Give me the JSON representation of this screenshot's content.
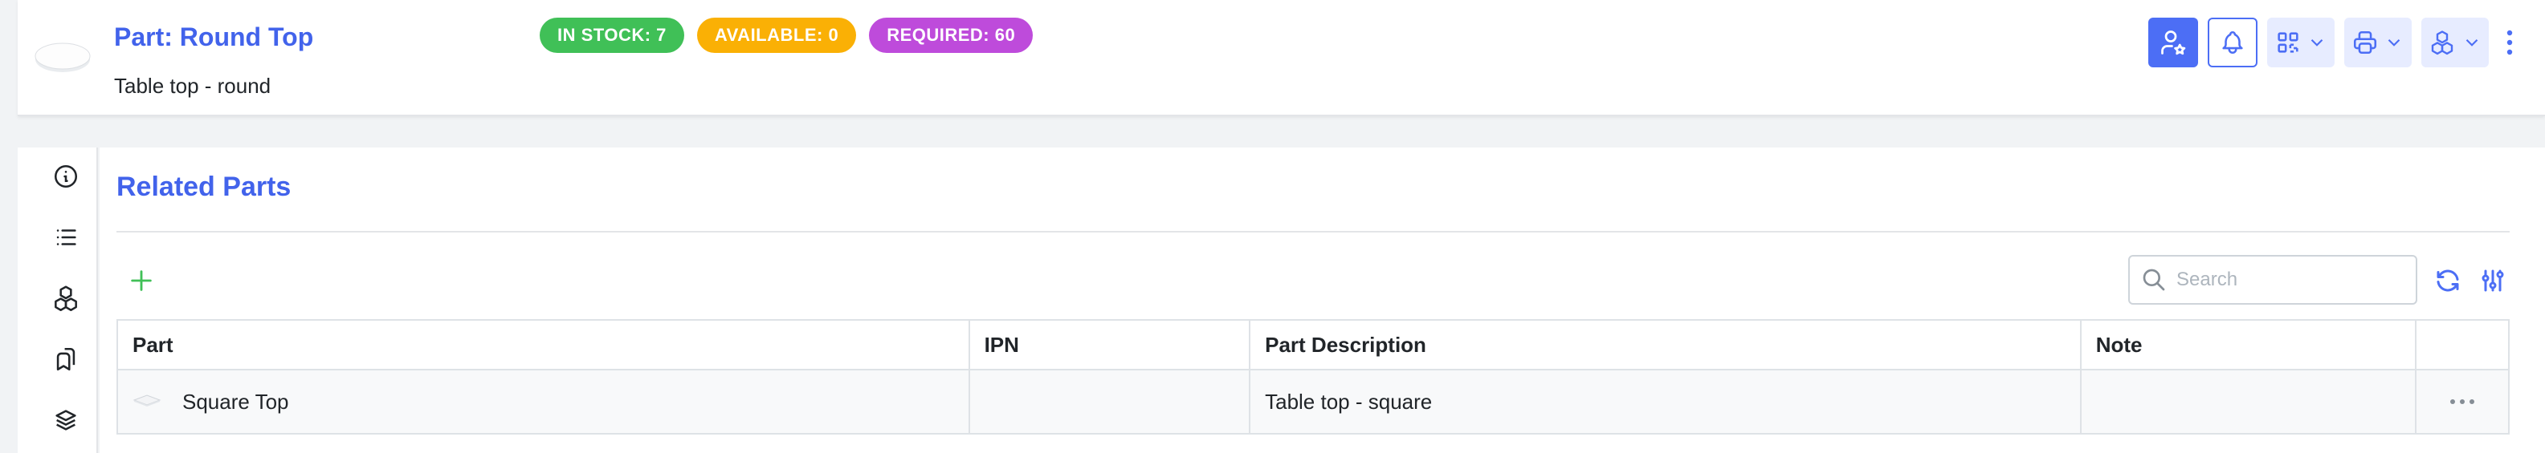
{
  "header": {
    "title": "Part: Round Top",
    "description": "Table top - round",
    "badges": [
      {
        "label": "IN STOCK: 7",
        "color": "#40c057"
      },
      {
        "label": "AVAILABLE: 0",
        "color": "#fab005"
      },
      {
        "label": "REQUIRED: 60",
        "color": "#be4bdb"
      }
    ],
    "actions": [
      "user-star-icon",
      "bell-icon",
      "qr-code-icon",
      "printer-icon",
      "boxes-icon",
      "more-vertical-icon"
    ]
  },
  "nav": {
    "items": [
      "info-icon",
      "list-icon",
      "boxes-icon",
      "bookmarks-icon",
      "layers-icon"
    ]
  },
  "panel": {
    "title": "Related Parts",
    "search_placeholder": "Search",
    "table": {
      "columns": [
        "Part",
        "IPN",
        "Part Description",
        "Note",
        ""
      ],
      "rows": [
        {
          "part": "Square Top",
          "ipn": "",
          "description": "Table top - square",
          "note": ""
        }
      ]
    }
  },
  "colors": {
    "accent": "#4263eb",
    "add": "#40c057"
  }
}
